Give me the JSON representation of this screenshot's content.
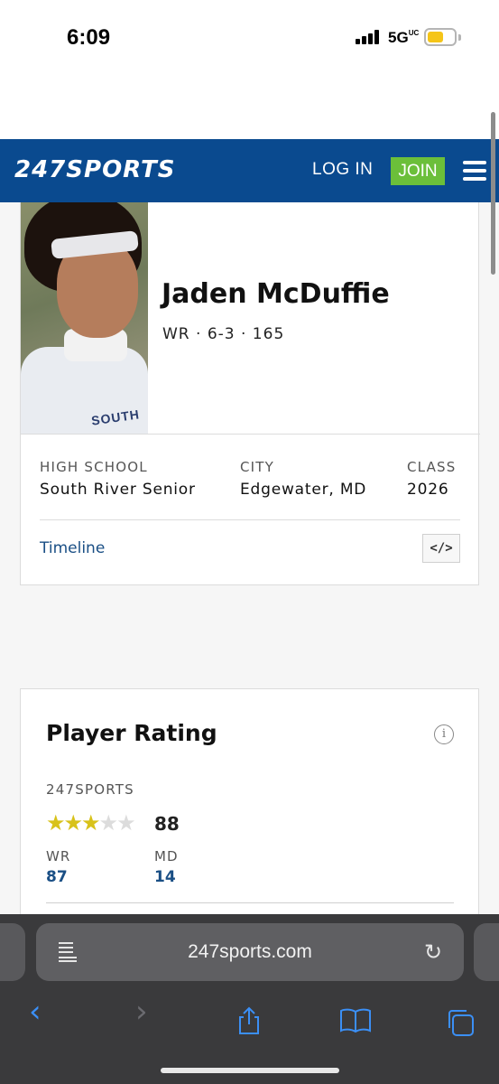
{
  "status_bar": {
    "time": "6:09",
    "network": "5G",
    "network_suffix": "UC",
    "battery_color": "#f5c518"
  },
  "header": {
    "logo_numeric": "247",
    "logo_text": "SPORTS",
    "login_label": "LOG IN",
    "join_label": "JOIN",
    "menu_icon": "hamburger-icon",
    "brand_color": "#0a4a8f",
    "accent_color": "#6bbf3a"
  },
  "player": {
    "name": "Jaden McDuffie",
    "meta": "WR · 6-3 · 165",
    "photo_text": "SOUTH",
    "info": [
      {
        "label": "HIGH SCHOOL",
        "value": "South River Senior"
      },
      {
        "label": "CITY",
        "value": "Edgewater, MD"
      },
      {
        "label": "CLASS",
        "value": "2026"
      }
    ],
    "timeline_label": "Timeline",
    "embed_label": "</>"
  },
  "rating": {
    "title": "Player Rating",
    "info_icon": "i",
    "source": "247SPORTS",
    "stars_filled": 3,
    "stars_total": 5,
    "score": "88",
    "ranks": [
      {
        "label": "WR",
        "value": "87"
      },
      {
        "label": "MD",
        "value": "14"
      }
    ]
  },
  "browser": {
    "url": "247sports.com",
    "reader_icon": "reader-icon",
    "reload_icon": "reload-icon",
    "toolbar": [
      "back-icon",
      "forward-icon",
      "share-icon",
      "bookmarks-icon",
      "tabs-icon"
    ]
  }
}
